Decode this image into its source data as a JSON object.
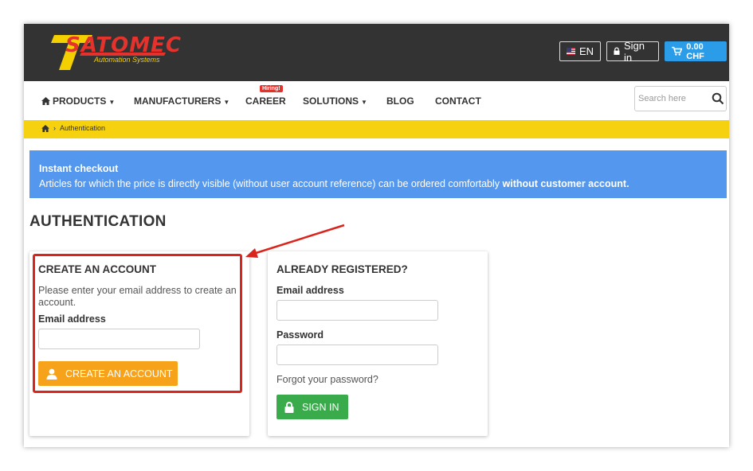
{
  "header": {
    "logo_text": "SATOMEC",
    "logo_tagline": "Automation Systems",
    "language": "EN",
    "sign_in": "Sign in",
    "cart_total": "0.00 CHF"
  },
  "nav": {
    "items": [
      {
        "label": "PRODUCTS",
        "dropdown": true
      },
      {
        "label": "MANUFACTURERS",
        "dropdown": true
      },
      {
        "label": "CAREER",
        "dropdown": false
      },
      {
        "label": "SOLUTIONS",
        "dropdown": true
      },
      {
        "label": "BLOG",
        "dropdown": false
      },
      {
        "label": "CONTACT",
        "dropdown": false
      }
    ],
    "career_badge": "Hiring!",
    "search_placeholder": "Search here"
  },
  "breadcrumb": {
    "current": "Authentication"
  },
  "alert": {
    "title": "Instant checkout",
    "text": "Articles for which the price is directly visible (without user account reference) can be ordered comfortably",
    "emphasis": "without customer account."
  },
  "page_title": "AUTHENTICATION",
  "create_account": {
    "title": "CREATE AN ACCOUNT",
    "description": "Please enter your email address to create an account.",
    "email_label": "Email address",
    "email_value": "",
    "button": "CREATE AN ACCOUNT"
  },
  "login": {
    "title": "ALREADY REGISTERED?",
    "email_label": "Email address",
    "email_value": "",
    "password_label": "Password",
    "password_value": "",
    "forgot": "Forgot your password?",
    "button": "SIGN IN"
  },
  "colors": {
    "header_bg": "#333333",
    "accent_yellow": "#f5d10f",
    "alert_blue": "#5497ee",
    "cart_blue": "#2b9de8",
    "create_orange": "#f7a21b",
    "signin_green": "#3aab4b",
    "annotation_red": "#d9251c"
  }
}
